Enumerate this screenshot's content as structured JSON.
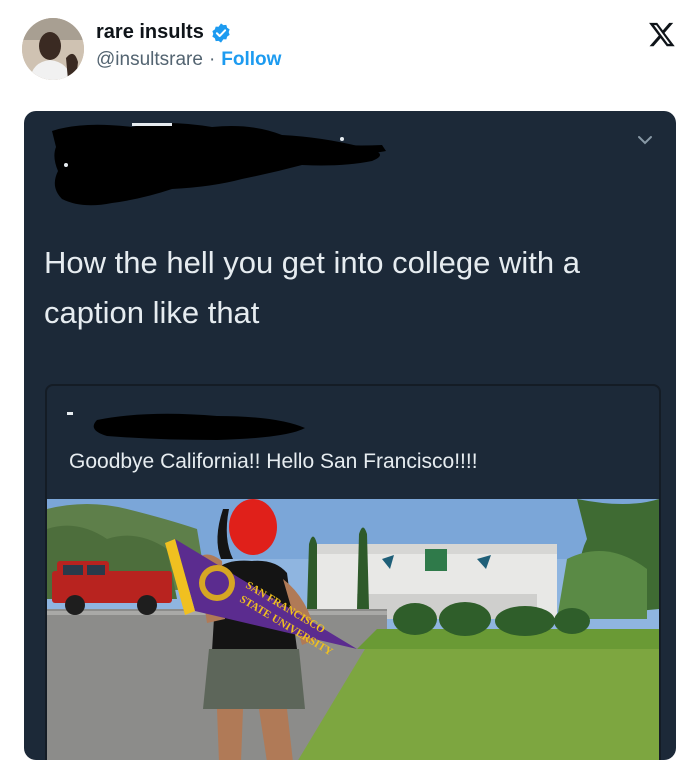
{
  "author": {
    "name": "rare insults",
    "handle": "@insultsrare",
    "separator": "·",
    "follow_label": "Follow"
  },
  "icons": {
    "verified": "verified-badge-icon",
    "logo": "x-logo-icon",
    "chevron": "chevron-down-icon"
  },
  "colors": {
    "accent": "#1d9bf0",
    "dark_bg": "#1c2938",
    "pennant": "#5b2c8f"
  },
  "screenshot": {
    "tweet_text": "How the hell you get into college with a caption like that",
    "quoted": {
      "text": "Goodbye California!! Hello San Francisco!!!!",
      "pennant_text_1": "SAN FRANCISCO",
      "pennant_text_2": "STATE UNIVERSITY"
    }
  }
}
